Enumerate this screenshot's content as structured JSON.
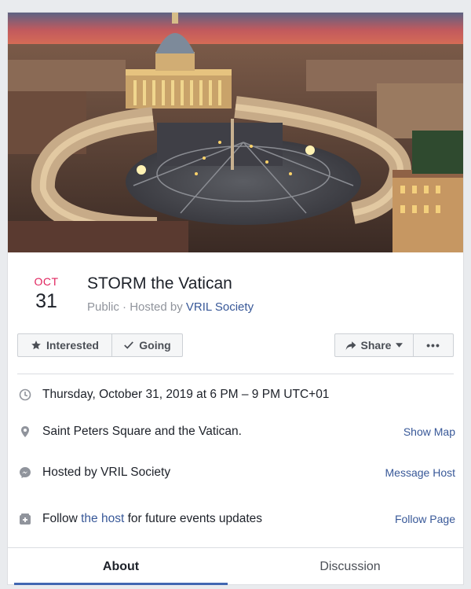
{
  "event": {
    "month": "OCT",
    "day": "31",
    "title": "STORM the Vatican",
    "privacy": "Public",
    "hosted_prefix": "Hosted by",
    "host_name": "VRIL Society",
    "sub_separator": " · "
  },
  "actions": {
    "interested_label": "Interested",
    "going_label": "Going",
    "share_label": "Share",
    "more_label": "•••"
  },
  "details": {
    "datetime": "Thursday, October 31, 2019 at 6 PM – 9 PM UTC+01",
    "location": "Saint Peters Square and the Vatican.",
    "location_action": "Show Map",
    "host_line": "Hosted by VRIL Society",
    "host_action": "Message Host",
    "follow_prefix": "Follow",
    "follow_link": "the host",
    "follow_suffix": "for future events updates",
    "follow_action": "Follow Page"
  },
  "tabs": [
    {
      "label": "About",
      "active": true
    },
    {
      "label": "Discussion",
      "active": false
    }
  ],
  "icons": {
    "interested": "star-icon",
    "going": "check-icon",
    "share": "share-arrow-icon",
    "share_menu": "caret-down-icon",
    "datetime": "clock-icon",
    "location": "map-pin-icon",
    "host": "messenger-icon",
    "follow": "follow-page-icon"
  },
  "colors": {
    "month_accent": "#e0245e",
    "link": "#385898",
    "tab_indicator": "#4267b2",
    "muted_text": "#90949c"
  }
}
